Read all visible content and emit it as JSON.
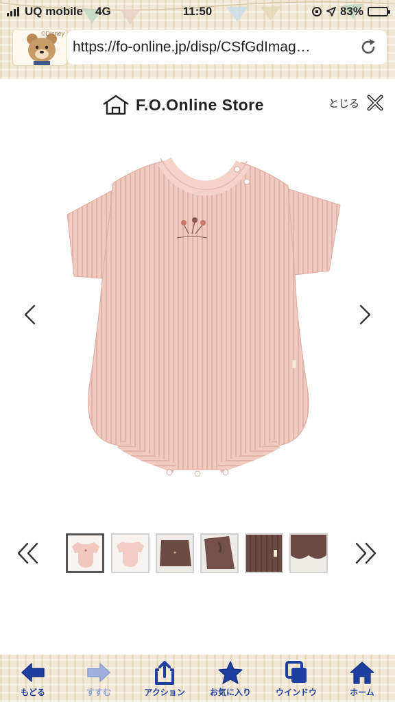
{
  "status_bar": {
    "carrier": "UQ mobile",
    "network": "4G",
    "time": "11:50",
    "battery_text": "83%",
    "battery_level": 0.83
  },
  "browser": {
    "url": "https://fo-online.jp/disp/CSfGdImag…",
    "tab_thumbnail_text": "©Disney"
  },
  "header": {
    "logo_text": "F.O.Online Store",
    "close_label": "とじる"
  },
  "product": {
    "color_main": "#f2cdc4",
    "color_alt": "#6b4a44",
    "thumbnails": [
      {
        "kind": "pink-front",
        "active": true
      },
      {
        "kind": "pink-back",
        "active": false
      },
      {
        "kind": "brown-front",
        "active": false
      },
      {
        "kind": "brown-detail",
        "active": false
      },
      {
        "kind": "brown-rib",
        "active": false
      },
      {
        "kind": "brown-hem",
        "active": false
      }
    ]
  },
  "toolbar": {
    "accent": "#1d3fa0",
    "items": [
      {
        "label": "もどる",
        "icon": "back-arrow-icon",
        "enabled": true
      },
      {
        "label": "すすむ",
        "icon": "forward-arrow-icon",
        "enabled": false
      },
      {
        "label": "アクション",
        "icon": "share-icon",
        "enabled": true
      },
      {
        "label": "お気に入り",
        "icon": "star-icon",
        "enabled": true
      },
      {
        "label": "ウインドウ",
        "icon": "windows-icon",
        "enabled": true
      },
      {
        "label": "ホーム",
        "icon": "home-icon",
        "enabled": true
      }
    ]
  }
}
